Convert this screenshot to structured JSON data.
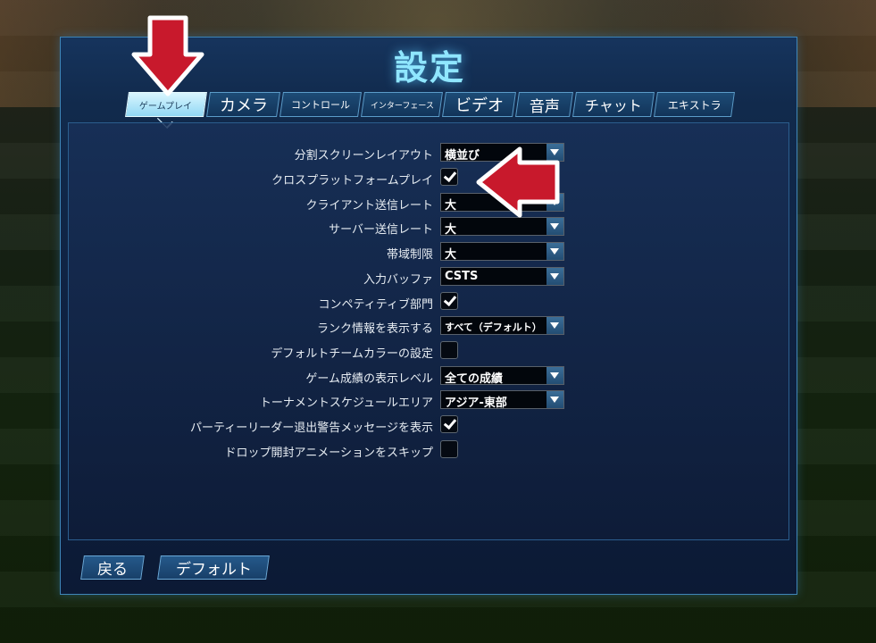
{
  "title": "設定",
  "tabs": [
    {
      "label": "ゲームプレイ",
      "active": true
    },
    {
      "label": "カメラ"
    },
    {
      "label": "コントロール"
    },
    {
      "label": "インターフェース"
    },
    {
      "label": "ビデオ"
    },
    {
      "label": "音声"
    },
    {
      "label": "チャット"
    },
    {
      "label": "エキストラ"
    }
  ],
  "settings": [
    {
      "label": "分割スクリーンレイアウト",
      "type": "select",
      "value": "横並び"
    },
    {
      "label": "クロスプラットフォームプレイ",
      "type": "checkbox",
      "checked": true
    },
    {
      "label": "クライアント送信レート",
      "type": "select",
      "value": "大"
    },
    {
      "label": "サーバー送信レート",
      "type": "select",
      "value": "大"
    },
    {
      "label": "帯域制限",
      "type": "select",
      "value": "大"
    },
    {
      "label": "入力バッファ",
      "type": "select",
      "value": "CSTS"
    },
    {
      "label": "コンペティティブ部門",
      "type": "checkbox",
      "checked": true
    },
    {
      "label": "ランク情報を表示する",
      "type": "select",
      "value": "すべて（デフォルト）"
    },
    {
      "label": "デフォルトチームカラーの設定",
      "type": "checkbox",
      "checked": false
    },
    {
      "label": "ゲーム成績の表示レベル",
      "type": "select",
      "value": "全ての成績"
    },
    {
      "label": "トーナメントスケジュールエリア",
      "type": "select",
      "value": "アジア-東部"
    },
    {
      "label": "パーティーリーダー退出警告メッセージを表示",
      "type": "checkbox",
      "checked": true
    },
    {
      "label": "ドロップ開封アニメーションをスキップ",
      "type": "checkbox",
      "checked": false
    }
  ],
  "buttons": {
    "back": "戻る",
    "default": "デフォルト"
  },
  "colors": {
    "accent": "#8fe6ff",
    "annotation_arrow": "#c8192c"
  }
}
